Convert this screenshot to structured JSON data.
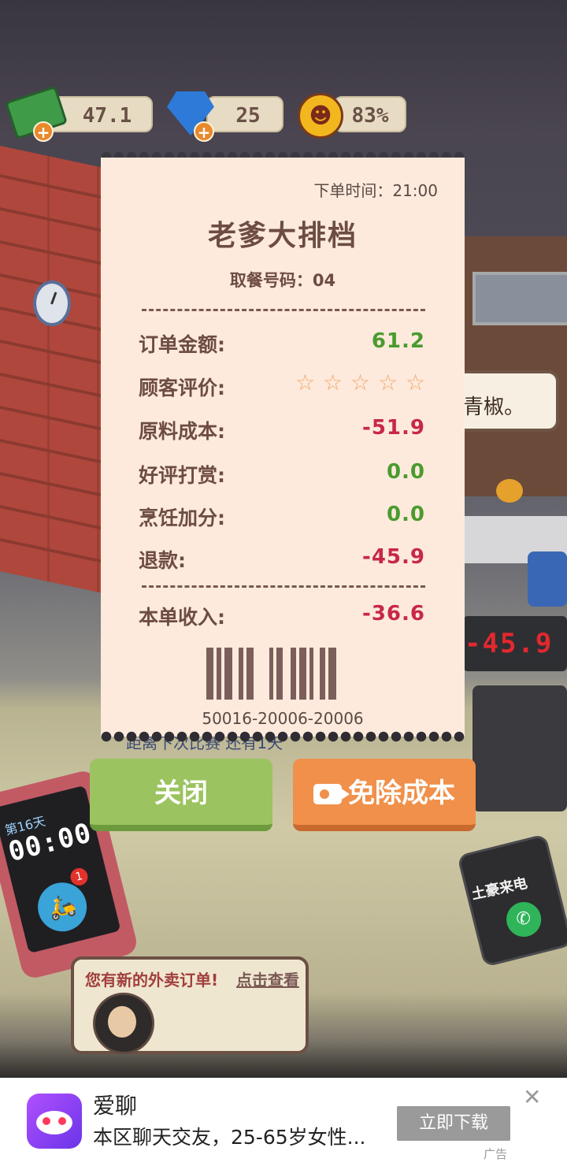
{
  "hud": {
    "cash": "47.1",
    "gems": "25",
    "satisfaction": "83%",
    "plus": "+"
  },
  "receipt": {
    "order_time": "下单时间：21:00",
    "shop_name": "老爹大排档",
    "pickup_number": "取餐号码：04",
    "rows": [
      {
        "label": "订单金额:",
        "value": "61.2"
      },
      {
        "label": "顾客评价:",
        "stars": 0,
        "max_stars": 5
      },
      {
        "label": "原料成本:",
        "value": "-51.9"
      },
      {
        "label": "好评打赏:",
        "value": "0.0"
      },
      {
        "label": "烹饪加分:",
        "value": "0.0"
      },
      {
        "label": "退款:",
        "value": "-45.9"
      }
    ],
    "total_label": "本单收入:",
    "total_value": "-36.6",
    "barcode_number": "50016-20006-20006"
  },
  "buttons": {
    "close": "关闭",
    "waive_cost": "免除成本"
  },
  "scene": {
    "customer_speech": "青椒。",
    "register_display": "-45.9",
    "counter_note": "距离下次比赛 还有1天",
    "phone_day": "第16天",
    "phone_time": "00:00",
    "delivery_badge": "1",
    "tyrant_call": "土豪来电",
    "new_order_text": "您有新的外卖订单!",
    "new_order_link": "点击查看"
  },
  "ad": {
    "title": "爱聊",
    "description": "本区聊天交友，25-65岁女性...",
    "cta": "立即下载",
    "tag": "广告",
    "close": "✕"
  },
  "colors": {
    "positive": "#4a9b2e",
    "negative": "#c8274a",
    "receipt_bg": "#fdeadc",
    "close_button": "#9bc35f",
    "waive_button": "#f0904a"
  }
}
